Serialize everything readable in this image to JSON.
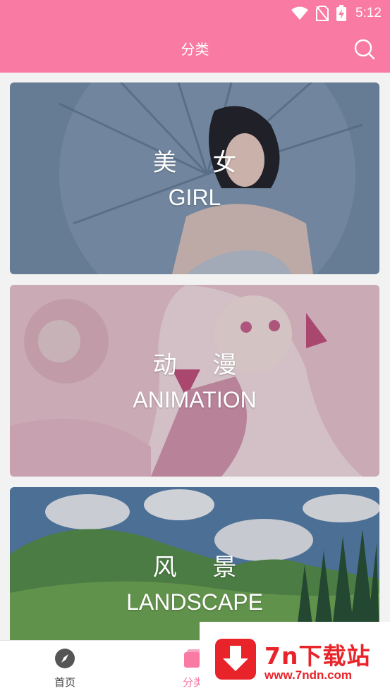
{
  "status_bar": {
    "time": "5:12"
  },
  "header": {
    "title": "分类"
  },
  "categories": [
    {
      "title_cn": "美 女",
      "title_en": "GIRL"
    },
    {
      "title_cn": "动 漫",
      "title_en": "ANIMATION"
    },
    {
      "title_cn": "风 景",
      "title_en": "LANDSCAPE"
    }
  ],
  "bottom_nav": {
    "items": [
      {
        "label": "首页",
        "icon": "compass-icon"
      },
      {
        "label": "分类",
        "icon": "category-icon"
      }
    ]
  },
  "promo": {
    "name": "7n下载站",
    "url": "www.7ndn.com"
  },
  "colors": {
    "accent": "#f97aa2",
    "promo_red": "#e8232a"
  }
}
